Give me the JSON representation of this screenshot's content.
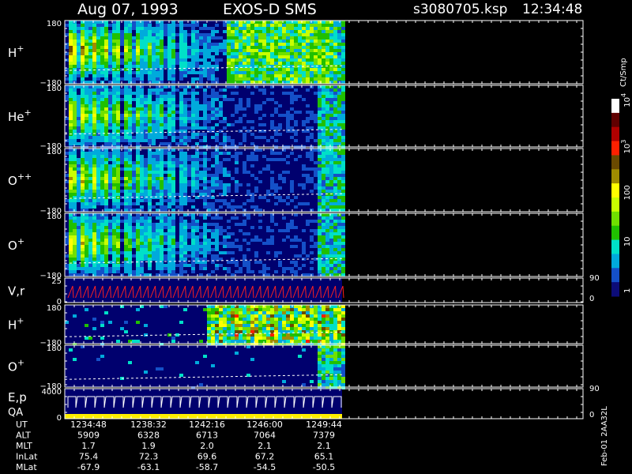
{
  "header": {
    "date": "Aug 07, 1993",
    "instrument": "EXOS-D SMS",
    "file": "s3080705.ksp",
    "time": "12:34:48"
  },
  "colorbar": {
    "unit": "Ct/Smp",
    "labels": [
      "1",
      "10",
      "100",
      "10",
      "10"
    ],
    "label_exponents": [
      "",
      "",
      "",
      "3",
      "4"
    ],
    "label_values": [
      1,
      10,
      100,
      1000,
      10000
    ],
    "colors": [
      "#0c0c78",
      "#1450c8",
      "#00aadc",
      "#00e0c8",
      "#20c000",
      "#70e000",
      "#c8ff00",
      "#ffff00",
      "#a08c00",
      "#6a4a00",
      "#ff2000",
      "#b00000",
      "#600000",
      "#ffffff"
    ]
  },
  "footer": {
    "rows": [
      {
        "label": "UT",
        "values": [
          "1234:48",
          "1238:32",
          "1242:16",
          "1246:00",
          "1249:44"
        ]
      },
      {
        "label": "ALT",
        "values": [
          "5909",
          "6328",
          "6713",
          "7064",
          "7379"
        ]
      },
      {
        "label": "MLT",
        "values": [
          "1.7",
          "1.9",
          "2.0",
          "2.1",
          "2.1"
        ]
      },
      {
        "label": "InLat",
        "values": [
          "75.4",
          "72.3",
          "69.6",
          "67.2",
          "65.1"
        ]
      },
      {
        "label": "MLat",
        "values": [
          "-67.9",
          "-63.1",
          "-58.7",
          "-54.5",
          "-50.5"
        ]
      }
    ],
    "side_label": "Feb-01 2AA32L"
  },
  "chart_data": {
    "type": "heatmap",
    "x_label": "UT",
    "x_ticks": [
      "1234:48",
      "1238:32",
      "1242:16",
      "1246:00",
      "1249:44"
    ],
    "panels": [
      {
        "label": "H",
        "superscript": "+",
        "ytop": "180",
        "ybottom": "−180",
        "kind": "pitch"
      },
      {
        "label": "He",
        "superscript": "+",
        "ytop": "180",
        "ybottom": "−180",
        "kind": "pitch"
      },
      {
        "label": "O",
        "superscript": "++",
        "ytop": "180",
        "ybottom": "−180",
        "kind": "pitch"
      },
      {
        "label": "O",
        "superscript": "+",
        "ytop": "180",
        "ybottom": "−180",
        "kind": "pitch"
      },
      {
        "label": "V,r",
        "superscript": "",
        "ytop": "25",
        "ybottom": "0",
        "right_top": "90",
        "right_bottom": "0",
        "kind": "line"
      },
      {
        "label": "H",
        "superscript": "+",
        "ytop": "180",
        "ybottom": "−180",
        "kind": "pitch"
      },
      {
        "label": "O",
        "superscript": "+",
        "ytop": "180",
        "ybottom": "−180",
        "kind": "pitch"
      },
      {
        "label": "E,p",
        "label2": "QA",
        "superscript": "",
        "ytop": "4000",
        "ybottom": "0",
        "right_top": "90",
        "right_bottom": "0",
        "kind": "line"
      }
    ]
  }
}
